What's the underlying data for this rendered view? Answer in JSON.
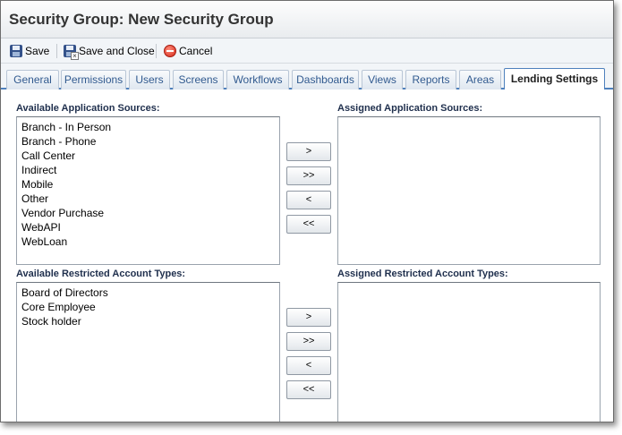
{
  "window": {
    "title": "Security Group: New Security Group"
  },
  "toolbar": {
    "save_label": "Save",
    "save_close_label": "Save and Close",
    "cancel_label": "Cancel"
  },
  "tabs": [
    {
      "label": "General",
      "active": false
    },
    {
      "label": "Permissions",
      "active": false
    },
    {
      "label": "Users",
      "active": false
    },
    {
      "label": "Screens",
      "active": false
    },
    {
      "label": "Workflows",
      "active": false
    },
    {
      "label": "Dashboards",
      "active": false
    },
    {
      "label": "Views",
      "active": false
    },
    {
      "label": "Reports",
      "active": false
    },
    {
      "label": "Areas",
      "active": false
    },
    {
      "label": "Lending Settings",
      "active": true
    }
  ],
  "application_sources": {
    "available_label": "Available Application Sources:",
    "assigned_label": "Assigned Application Sources:",
    "available": [
      "Branch - In Person",
      "Branch - Phone",
      "Call Center",
      "Indirect",
      "Mobile",
      "Other",
      "Vendor Purchase",
      "WebAPI",
      "WebLoan"
    ],
    "assigned": []
  },
  "restricted_account_types": {
    "available_label": "Available Restricted Account Types:",
    "assigned_label": "Assigned Restricted Account Types:",
    "available": [
      "Board of Directors",
      "Core Employee",
      "Stock holder"
    ],
    "assigned": []
  },
  "move_buttons": {
    "add": ">",
    "add_all": ">>",
    "remove": "<",
    "remove_all": "<<"
  },
  "colors": {
    "tab_accent": "#4f81bd",
    "tab_text": "#315a8f",
    "label_text": "#1f2f4d"
  }
}
